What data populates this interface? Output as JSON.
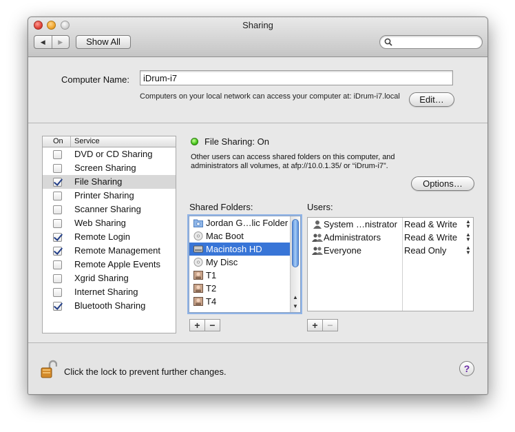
{
  "window": {
    "title": "Sharing",
    "nav_back": "◀",
    "nav_forward": "▶",
    "show_all": "Show All",
    "search_placeholder": ""
  },
  "computer_name": {
    "label": "Computer Name:",
    "value": "iDrum-i7",
    "note": "Computers on your local network can access your computer at: iDrum-i7.local",
    "edit_button": "Edit…"
  },
  "services": {
    "header_on": "On",
    "header_service": "Service",
    "items": [
      {
        "label": "DVD or CD Sharing",
        "on": false,
        "selected": false
      },
      {
        "label": "Screen Sharing",
        "on": false,
        "selected": false
      },
      {
        "label": "File Sharing",
        "on": true,
        "selected": true
      },
      {
        "label": "Printer Sharing",
        "on": false,
        "selected": false
      },
      {
        "label": "Scanner Sharing",
        "on": false,
        "selected": false
      },
      {
        "label": "Web Sharing",
        "on": false,
        "selected": false
      },
      {
        "label": "Remote Login",
        "on": true,
        "selected": false
      },
      {
        "label": "Remote Management",
        "on": true,
        "selected": false
      },
      {
        "label": "Remote Apple Events",
        "on": false,
        "selected": false
      },
      {
        "label": "Xgrid Sharing",
        "on": false,
        "selected": false
      },
      {
        "label": "Internet Sharing",
        "on": false,
        "selected": false
      },
      {
        "label": "Bluetooth Sharing",
        "on": true,
        "selected": false
      }
    ]
  },
  "file_sharing": {
    "status": "File Sharing: On",
    "description": "Other users can access shared folders on this computer, and administrators all volumes, at afp://10.0.1.35/ or “iDrum-i7”.",
    "options_button": "Options…",
    "status_color": "#45c41a"
  },
  "shared_folders": {
    "label": "Shared Folders:",
    "items": [
      {
        "label": "Jordan G…lic Folder",
        "icon": "folder-icon",
        "selected": false
      },
      {
        "label": "Mac Boot",
        "icon": "disk-icon",
        "selected": false
      },
      {
        "label": "Macintosh HD",
        "icon": "hard-drive-icon",
        "selected": true
      },
      {
        "label": "My Disc",
        "icon": "disk-icon",
        "selected": false
      },
      {
        "label": "T1",
        "icon": "user-photo-icon",
        "selected": false
      },
      {
        "label": "T2",
        "icon": "user-photo-icon",
        "selected": false
      },
      {
        "label": "T4",
        "icon": "user-photo-icon",
        "selected": false
      }
    ],
    "add": "+",
    "remove": "−"
  },
  "users": {
    "label": "Users:",
    "items": [
      {
        "name": "System …nistrator",
        "privilege": "Read & Write",
        "icon": "user-icon"
      },
      {
        "name": "Administrators",
        "privilege": "Read & Write",
        "icon": "group-icon"
      },
      {
        "name": "Everyone",
        "privilege": "Read Only",
        "icon": "group-icon"
      }
    ],
    "add": "+",
    "remove": "−"
  },
  "footer": {
    "lock_text": "Click the lock to prevent further changes.",
    "help": "?"
  }
}
